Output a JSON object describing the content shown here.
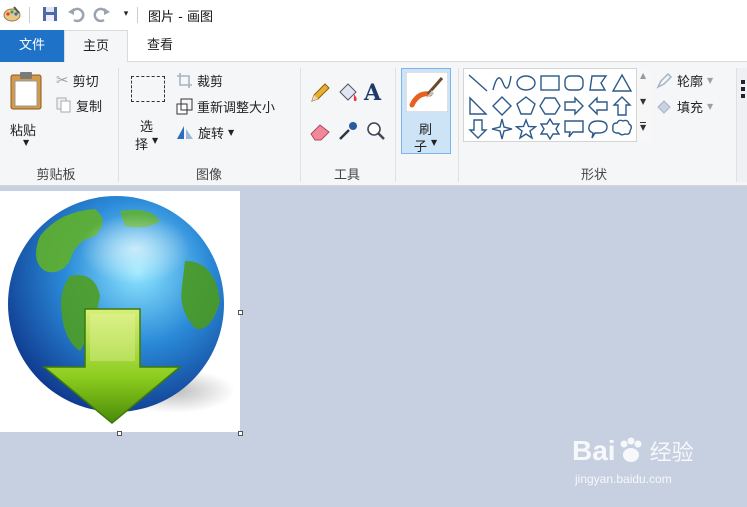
{
  "titlebar": {
    "title": "图片 - 画图"
  },
  "tabs": {
    "file": "文件",
    "home": "主页",
    "view": "查看"
  },
  "clipboard": {
    "paste": "粘贴",
    "cut": "剪切",
    "copy": "复制",
    "group": "剪贴板"
  },
  "image": {
    "select_line1": "选",
    "select_line2": "择",
    "crop": "裁剪",
    "resize": "重新调整大小",
    "rotate": "旋转",
    "group": "图像"
  },
  "tools": {
    "text_tool": "A",
    "group": "工具"
  },
  "brushes": {
    "line1": "刷",
    "line2": "子"
  },
  "shapes": {
    "outline": "轮廓",
    "fill": "填充",
    "group": "形状"
  },
  "watermark": {
    "brand": "Bai",
    "brand2": "经验",
    "url": "jingyan.baidu.com"
  },
  "colors": {
    "accent": "#1e73c9",
    "ribbon_bg": "#f5f6f7",
    "workspace": "#c6d0e1",
    "brush_highlight": "#cde4f7"
  }
}
